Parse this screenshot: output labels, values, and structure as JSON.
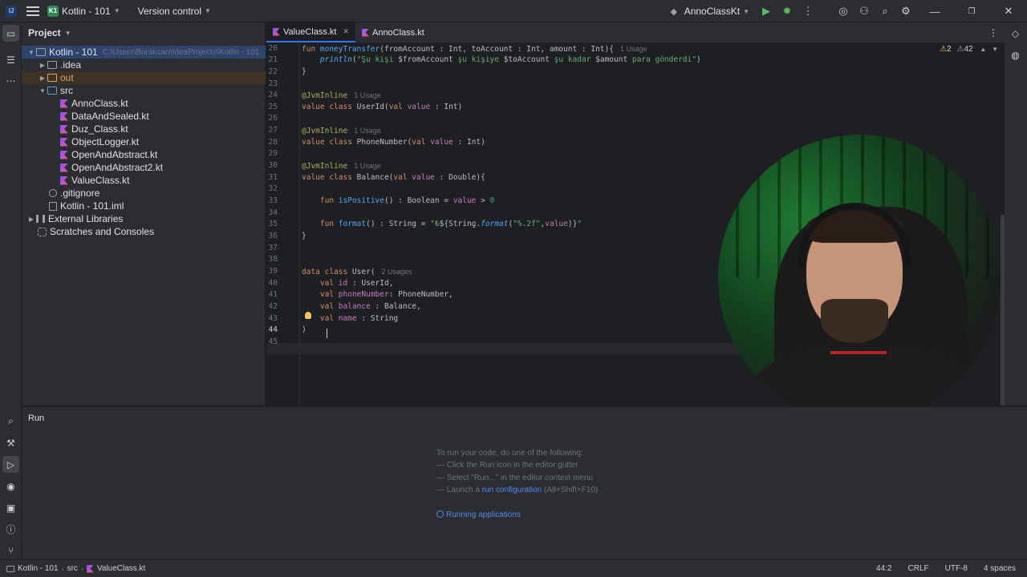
{
  "titlebar": {
    "project_badge": "K1",
    "project_name": "Kotlin - 101",
    "vcs": "Version control",
    "run_config": "AnnoClassKt"
  },
  "toolstrip": {
    "bottom_label": "Run"
  },
  "project_panel": {
    "title": "Project",
    "root_name": "Kotlin - 101",
    "root_path": "C:\\Users\\Burakcan\\IdeaProjects\\Kotlin - 101",
    "items": [
      {
        "label": ".idea"
      },
      {
        "label": "out"
      },
      {
        "label": "src"
      },
      {
        "label": "AnnoClass.kt"
      },
      {
        "label": "DataAndSealed.kt"
      },
      {
        "label": "Duz_Class.kt"
      },
      {
        "label": "ObjectLogger.kt"
      },
      {
        "label": "OpenAndAbstract.kt"
      },
      {
        "label": "OpenAndAbstract2.kt"
      },
      {
        "label": "ValueClass.kt"
      },
      {
        "label": ".gitignore"
      },
      {
        "label": "Kotlin - 101.iml"
      },
      {
        "label": "External Libraries"
      },
      {
        "label": "Scratches and Consoles"
      }
    ]
  },
  "editor": {
    "tabs": [
      {
        "label": "ValueClass.kt"
      },
      {
        "label": "AnnoClass.kt"
      }
    ],
    "inspections": {
      "warnings": "2",
      "weak": "42"
    },
    "usage_hints": {
      "one": "1 Usage",
      "two": "2 Usages"
    },
    "lines": {
      "l20": "20",
      "l21": "21",
      "l22": "22",
      "l23": "23",
      "l24": "24",
      "l25": "25",
      "l26": "26",
      "l27": "27",
      "l28": "28",
      "l29": "29",
      "l30": "30",
      "l31": "31",
      "l32": "32",
      "l33": "33",
      "l34": "34",
      "l35": "35",
      "l36": "36",
      "l37": "37",
      "l38": "38",
      "l39": "39",
      "l40": "40",
      "l41": "41",
      "l42": "42",
      "l43": "43",
      "l44": "44",
      "l45": "45"
    }
  },
  "run_panel": {
    "title": "Run",
    "hint_intro": "To run your code, do one of the following:",
    "hint_1": "— Click the Run icon in the editor gutter",
    "hint_2": "— Select \"Run...\" in the editor context menu",
    "hint_3_prefix": "— Launch a",
    "hint_3_link": "run configuration",
    "hint_3_suffix": "(Alt+Shift+F10)",
    "running_apps": "Running applications"
  },
  "statusbar": {
    "crumb_project": "Kotlin - 101",
    "crumb_src": "src",
    "crumb_file": "ValueClass.kt",
    "position": "44:2",
    "line_sep": "CRLF",
    "encoding": "UTF-8",
    "indent": "4 spaces"
  },
  "colors": {
    "accent": "#3574f0",
    "link": "#548af7",
    "keyword": "#cf8e6d",
    "function": "#56a8f5",
    "string": "#6aab73"
  }
}
